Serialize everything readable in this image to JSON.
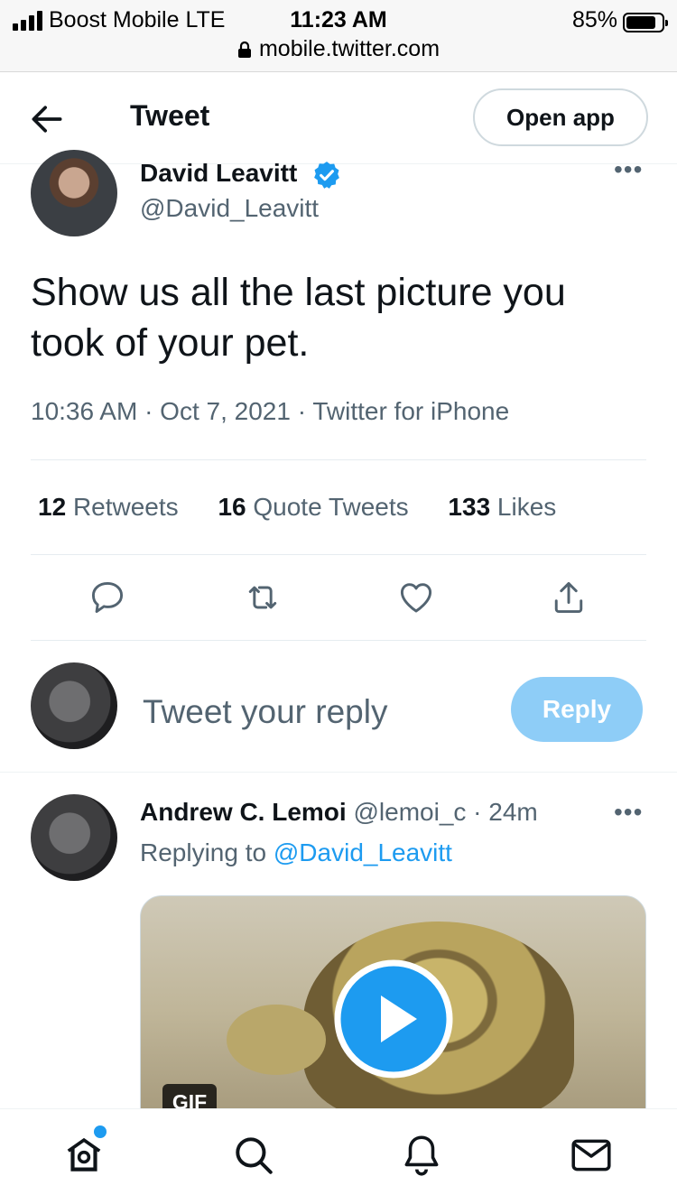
{
  "status_bar": {
    "carrier": "Boost Mobile  LTE",
    "time": "11:23 AM",
    "battery_percent": "85%",
    "battery_level": 0.85,
    "signal_bars": 4
  },
  "browser": {
    "url": "mobile.twitter.com"
  },
  "header": {
    "title": "Tweet",
    "open_app_label": "Open app"
  },
  "tweet": {
    "author_name": "David Leavitt",
    "author_handle": "@David_Leavitt",
    "text": "Show us all the last picture you took of your pet.",
    "meta": "10:36 AM · Oct 7, 2021 · Twitter for iPhone",
    "stats": {
      "retweets_count": "12",
      "retweets_label": "Retweets",
      "quotes_count": "16",
      "quotes_label": "Quote Tweets",
      "likes_count": "133",
      "likes_label": "Likes"
    },
    "more": "•••"
  },
  "composer": {
    "placeholder": "Tweet your reply",
    "reply_label": "Reply"
  },
  "reply": {
    "author_name": "Andrew C. Lemoi",
    "meta": "@lemoi_c · 24m",
    "replying_prefix": "Replying to ",
    "replying_to": "@David_Leavitt",
    "media_badge": "GIF",
    "more": "•••"
  },
  "icons": {
    "back": "arrow-left-icon",
    "verified": "verified-badge-icon",
    "lock": "lock-icon",
    "reply": "reply-icon",
    "retweet": "retweet-icon",
    "like": "heart-icon",
    "share": "share-icon",
    "play": "play-icon",
    "home": "home-icon",
    "search": "search-icon",
    "notifications": "bell-icon",
    "messages": "mail-icon"
  },
  "colors": {
    "accent": "#1d9bf0",
    "reply_button_disabled": "#8ecdf7",
    "secondary_text": "#536471",
    "primary_text": "#0f1419"
  }
}
